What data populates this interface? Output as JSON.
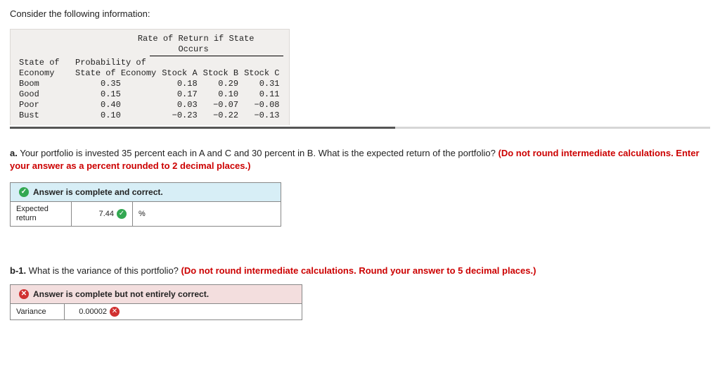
{
  "intro": "Consider the following information:",
  "chart_data": {
    "type": "table",
    "spanning_header": "Rate of Return if State Occurs",
    "columns": [
      "State of Economy",
      "Probability of State of Economy",
      "Stock A",
      "Stock B",
      "Stock C"
    ],
    "rows": [
      {
        "state": "Boom",
        "prob": "0.35",
        "a": "0.18",
        "b": "0.29",
        "c": "0.31"
      },
      {
        "state": "Good",
        "prob": "0.15",
        "a": "0.17",
        "b": "0.10",
        "c": "0.11"
      },
      {
        "state": "Poor",
        "prob": "0.40",
        "a": "0.03",
        "b": "−0.07",
        "c": "−0.08"
      },
      {
        "state": "Bust",
        "prob": "0.10",
        "a": "−0.23",
        "b": "−0.22",
        "c": "−0.13"
      }
    ]
  },
  "qa": {
    "label": "a.",
    "text_normal_1": " Your portfolio is invested 35 percent each in A and C and 30 percent in B. What is the expected return of the portfolio? ",
    "text_red": "(Do not round intermediate calculations. Enter your answer as a percent rounded to 2 decimal places.)",
    "feedback_header": "Answer is complete and correct.",
    "answer_label": "Expected return",
    "answer_value": "7.44",
    "answer_unit": "%"
  },
  "qb1": {
    "label": "b-1.",
    "text_normal_1": " What is the variance of this portfolio? ",
    "text_red": "(Do not round intermediate calculations. Round your answer to 5 decimal places.)",
    "feedback_header": "Answer is complete but not entirely correct.",
    "answer_label": "Variance",
    "answer_value": "0.00002"
  },
  "icons": {
    "check": "✓",
    "cross": "✕"
  }
}
